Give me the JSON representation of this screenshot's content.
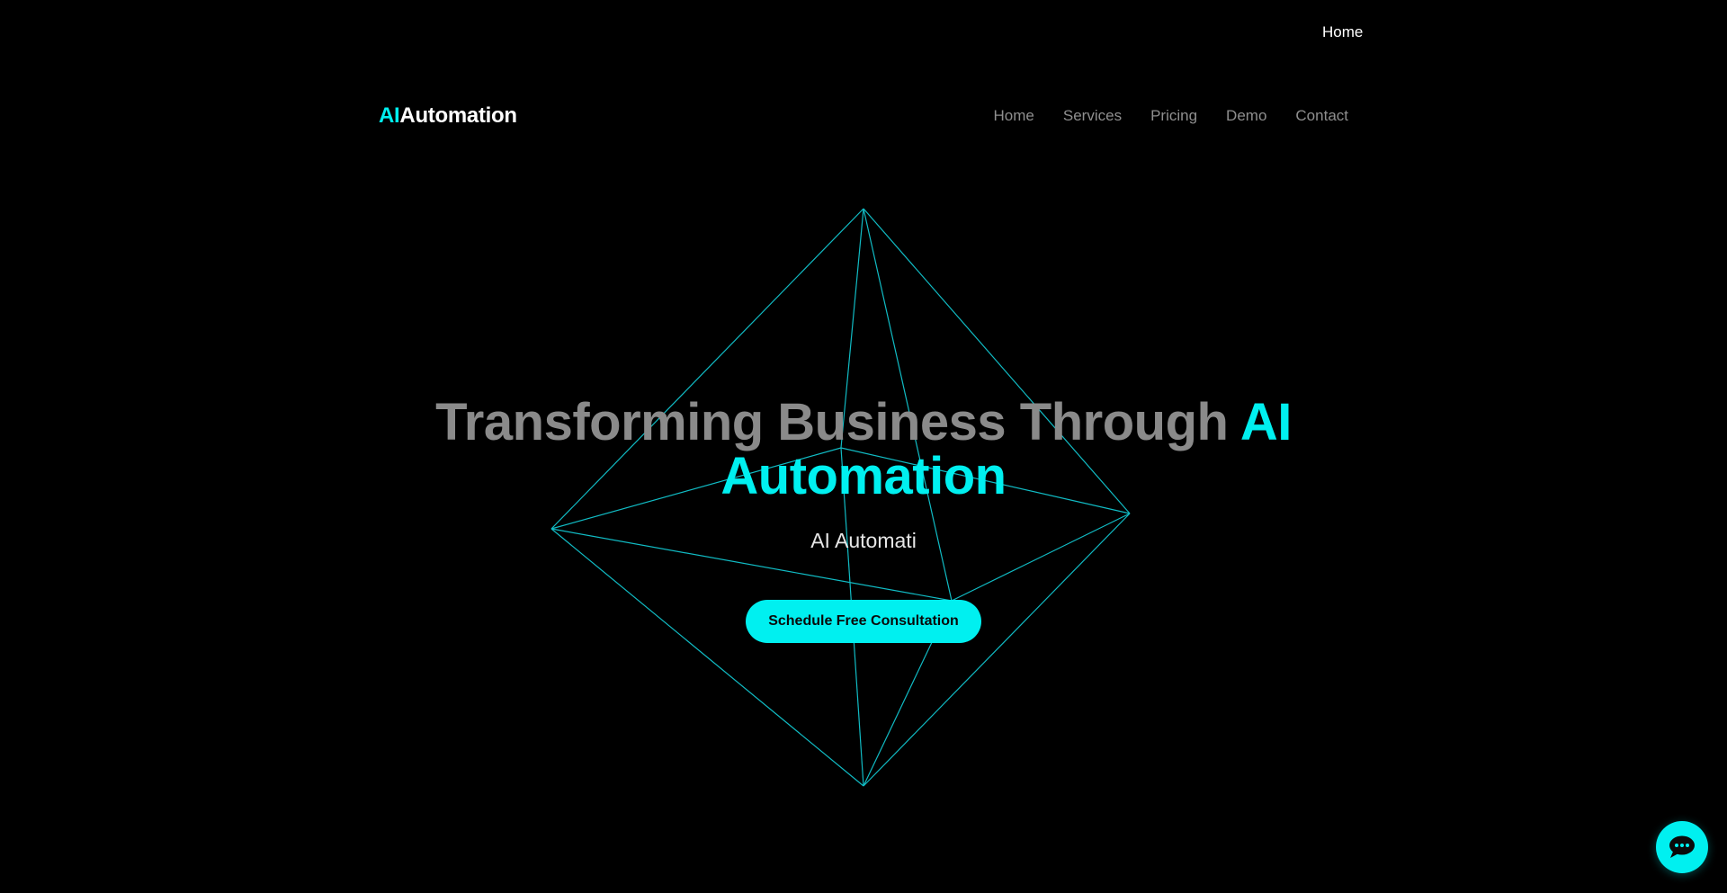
{
  "top_link": {
    "label": "Home"
  },
  "brand": {
    "accent": "AI",
    "rest": "Automation",
    "accent_color": "#00f0f0"
  },
  "nav": {
    "items": [
      {
        "label": "Home"
      },
      {
        "label": "Services"
      },
      {
        "label": "Pricing"
      },
      {
        "label": "Demo"
      },
      {
        "label": "Contact"
      }
    ]
  },
  "hero": {
    "title_main": "Transforming Business Through ",
    "title_accent_1": "AI",
    "title_accent_2": "Automation",
    "subtitle": "AI Automati",
    "cta_label": "Schedule Free Consultation"
  },
  "chat": {
    "icon": "chat-bubble-icon"
  },
  "colors": {
    "background": "#000000",
    "accent": "#00f0f0",
    "nav_text": "#8f8f8f",
    "title_gray": "#8a8a8a"
  }
}
